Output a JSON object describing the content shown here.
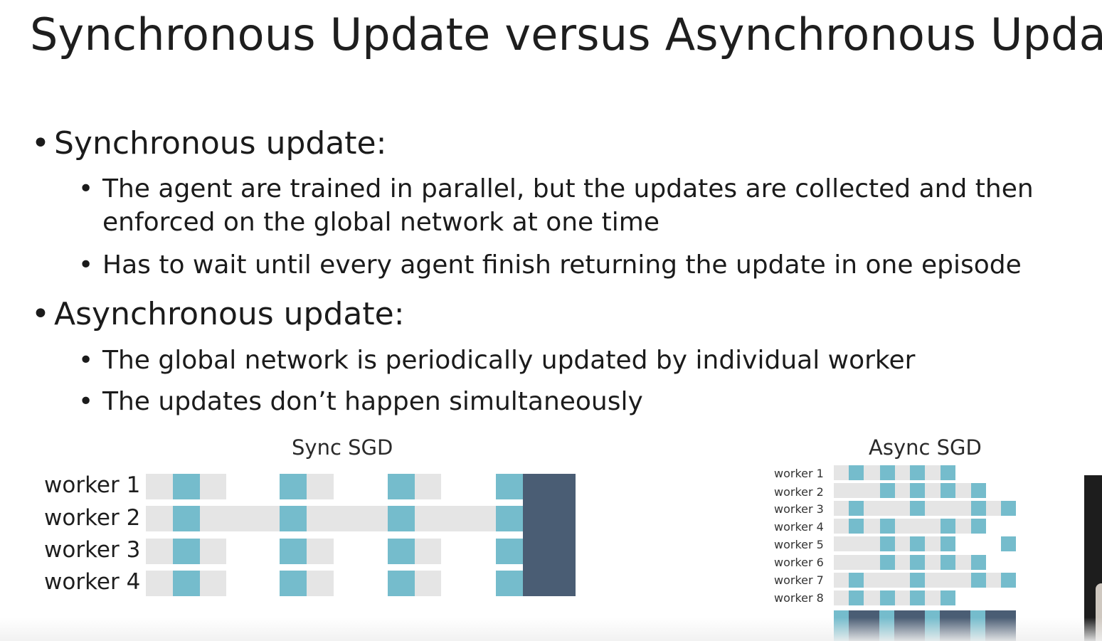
{
  "title": "Synchronous Update versus Asynchronous Update",
  "bullets": [
    {
      "label": "Synchronous update:",
      "sub": [
        [
          "The agent are trained in parallel, but the updates are collected and then",
          "enforced on the global network at one time"
        ],
        [
          "Has to wait until every agent finish returning the update in one episode"
        ]
      ]
    },
    {
      "label": "Asynchronous update:",
      "sub": [
        [
          "The global network is periodically updated by individual worker"
        ],
        [
          "The updates don’t happen simultaneously"
        ]
      ]
    }
  ],
  "sync_diagram": {
    "title": "Sync SGD",
    "workers": [
      "worker 1",
      "worker 2",
      "worker 3",
      "worker 4"
    ]
  },
  "async_diagram": {
    "title": "Async SGD",
    "workers": [
      "worker 1",
      "worker 2",
      "worker 3",
      "worker 4",
      "worker 5",
      "worker 6",
      "worker 7",
      "worker 8"
    ]
  },
  "colors": {
    "bar_bg": "#e5e5e5",
    "update_block": "#75bccc",
    "global_update": "#4a5d74",
    "text": "#1c1c1c"
  }
}
